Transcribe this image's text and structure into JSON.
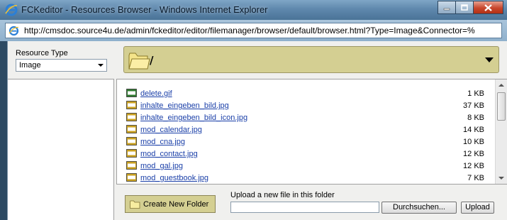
{
  "window": {
    "title": "FCKeditor - Resources Browser - Windows Internet Explorer",
    "url": "http://cmsdoc.source4u.de/admin/fckeditor/editor/filemanager/browser/default/browser.html?Type=Image&Connector=%"
  },
  "resource_type": {
    "label": "Resource Type",
    "selected": "Image"
  },
  "folder": {
    "current_path": "/"
  },
  "files": [
    {
      "name": "delete.gif",
      "size": "1 KB",
      "icon": "gif-file-icon"
    },
    {
      "name": "inhalte_eingeben_bild.jpg",
      "size": "37 KB",
      "icon": "jpg-file-icon"
    },
    {
      "name": "inhalte_eingeben_bild_icon.jpg",
      "size": "8 KB",
      "icon": "jpg-file-icon"
    },
    {
      "name": "mod_calendar.jpg",
      "size": "14 KB",
      "icon": "jpg-file-icon"
    },
    {
      "name": "mod_cna.jpg",
      "size": "10 KB",
      "icon": "jpg-file-icon"
    },
    {
      "name": "mod_contact.jpg",
      "size": "12 KB",
      "icon": "jpg-file-icon"
    },
    {
      "name": "mod_gal.jpg",
      "size": "12 KB",
      "icon": "jpg-file-icon"
    },
    {
      "name": "mod_guestbook.jpg",
      "size": "7 KB",
      "icon": "jpg-file-icon"
    }
  ],
  "actions": {
    "create_folder_label": "Create New Folder",
    "upload_label": "Upload a new file in this folder",
    "browse_label": "Durchsuchen...",
    "upload_button_label": "Upload"
  },
  "colors": {
    "folder_bar": "#d4cf92",
    "link": "#1a3fa8",
    "title_bar": "#5f88ad"
  }
}
